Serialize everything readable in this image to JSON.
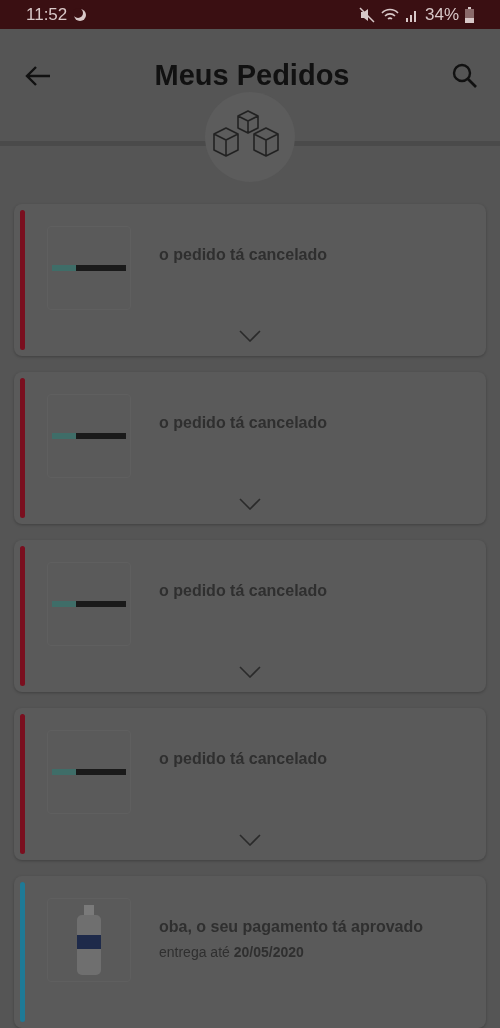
{
  "status_bar": {
    "time": "11:52",
    "battery": "34%"
  },
  "header": {
    "title": "Meus Pedidos"
  },
  "orders": [
    {
      "kind": "cancelled",
      "color": "#7a0f1f",
      "status": "o pedido tá cancelado"
    },
    {
      "kind": "cancelled",
      "color": "#7a0f1f",
      "status": "o pedido tá cancelado"
    },
    {
      "kind": "cancelled",
      "color": "#7a0f1f",
      "status": "o pedido tá cancelado"
    },
    {
      "kind": "cancelled",
      "color": "#7a0f1f",
      "status": "o pedido tá cancelado"
    },
    {
      "kind": "approved",
      "color": "#1f7a96",
      "status": "oba, o seu pagamento tá aprovado",
      "delivery": "entrega até **20/05/2020**"
    }
  ]
}
